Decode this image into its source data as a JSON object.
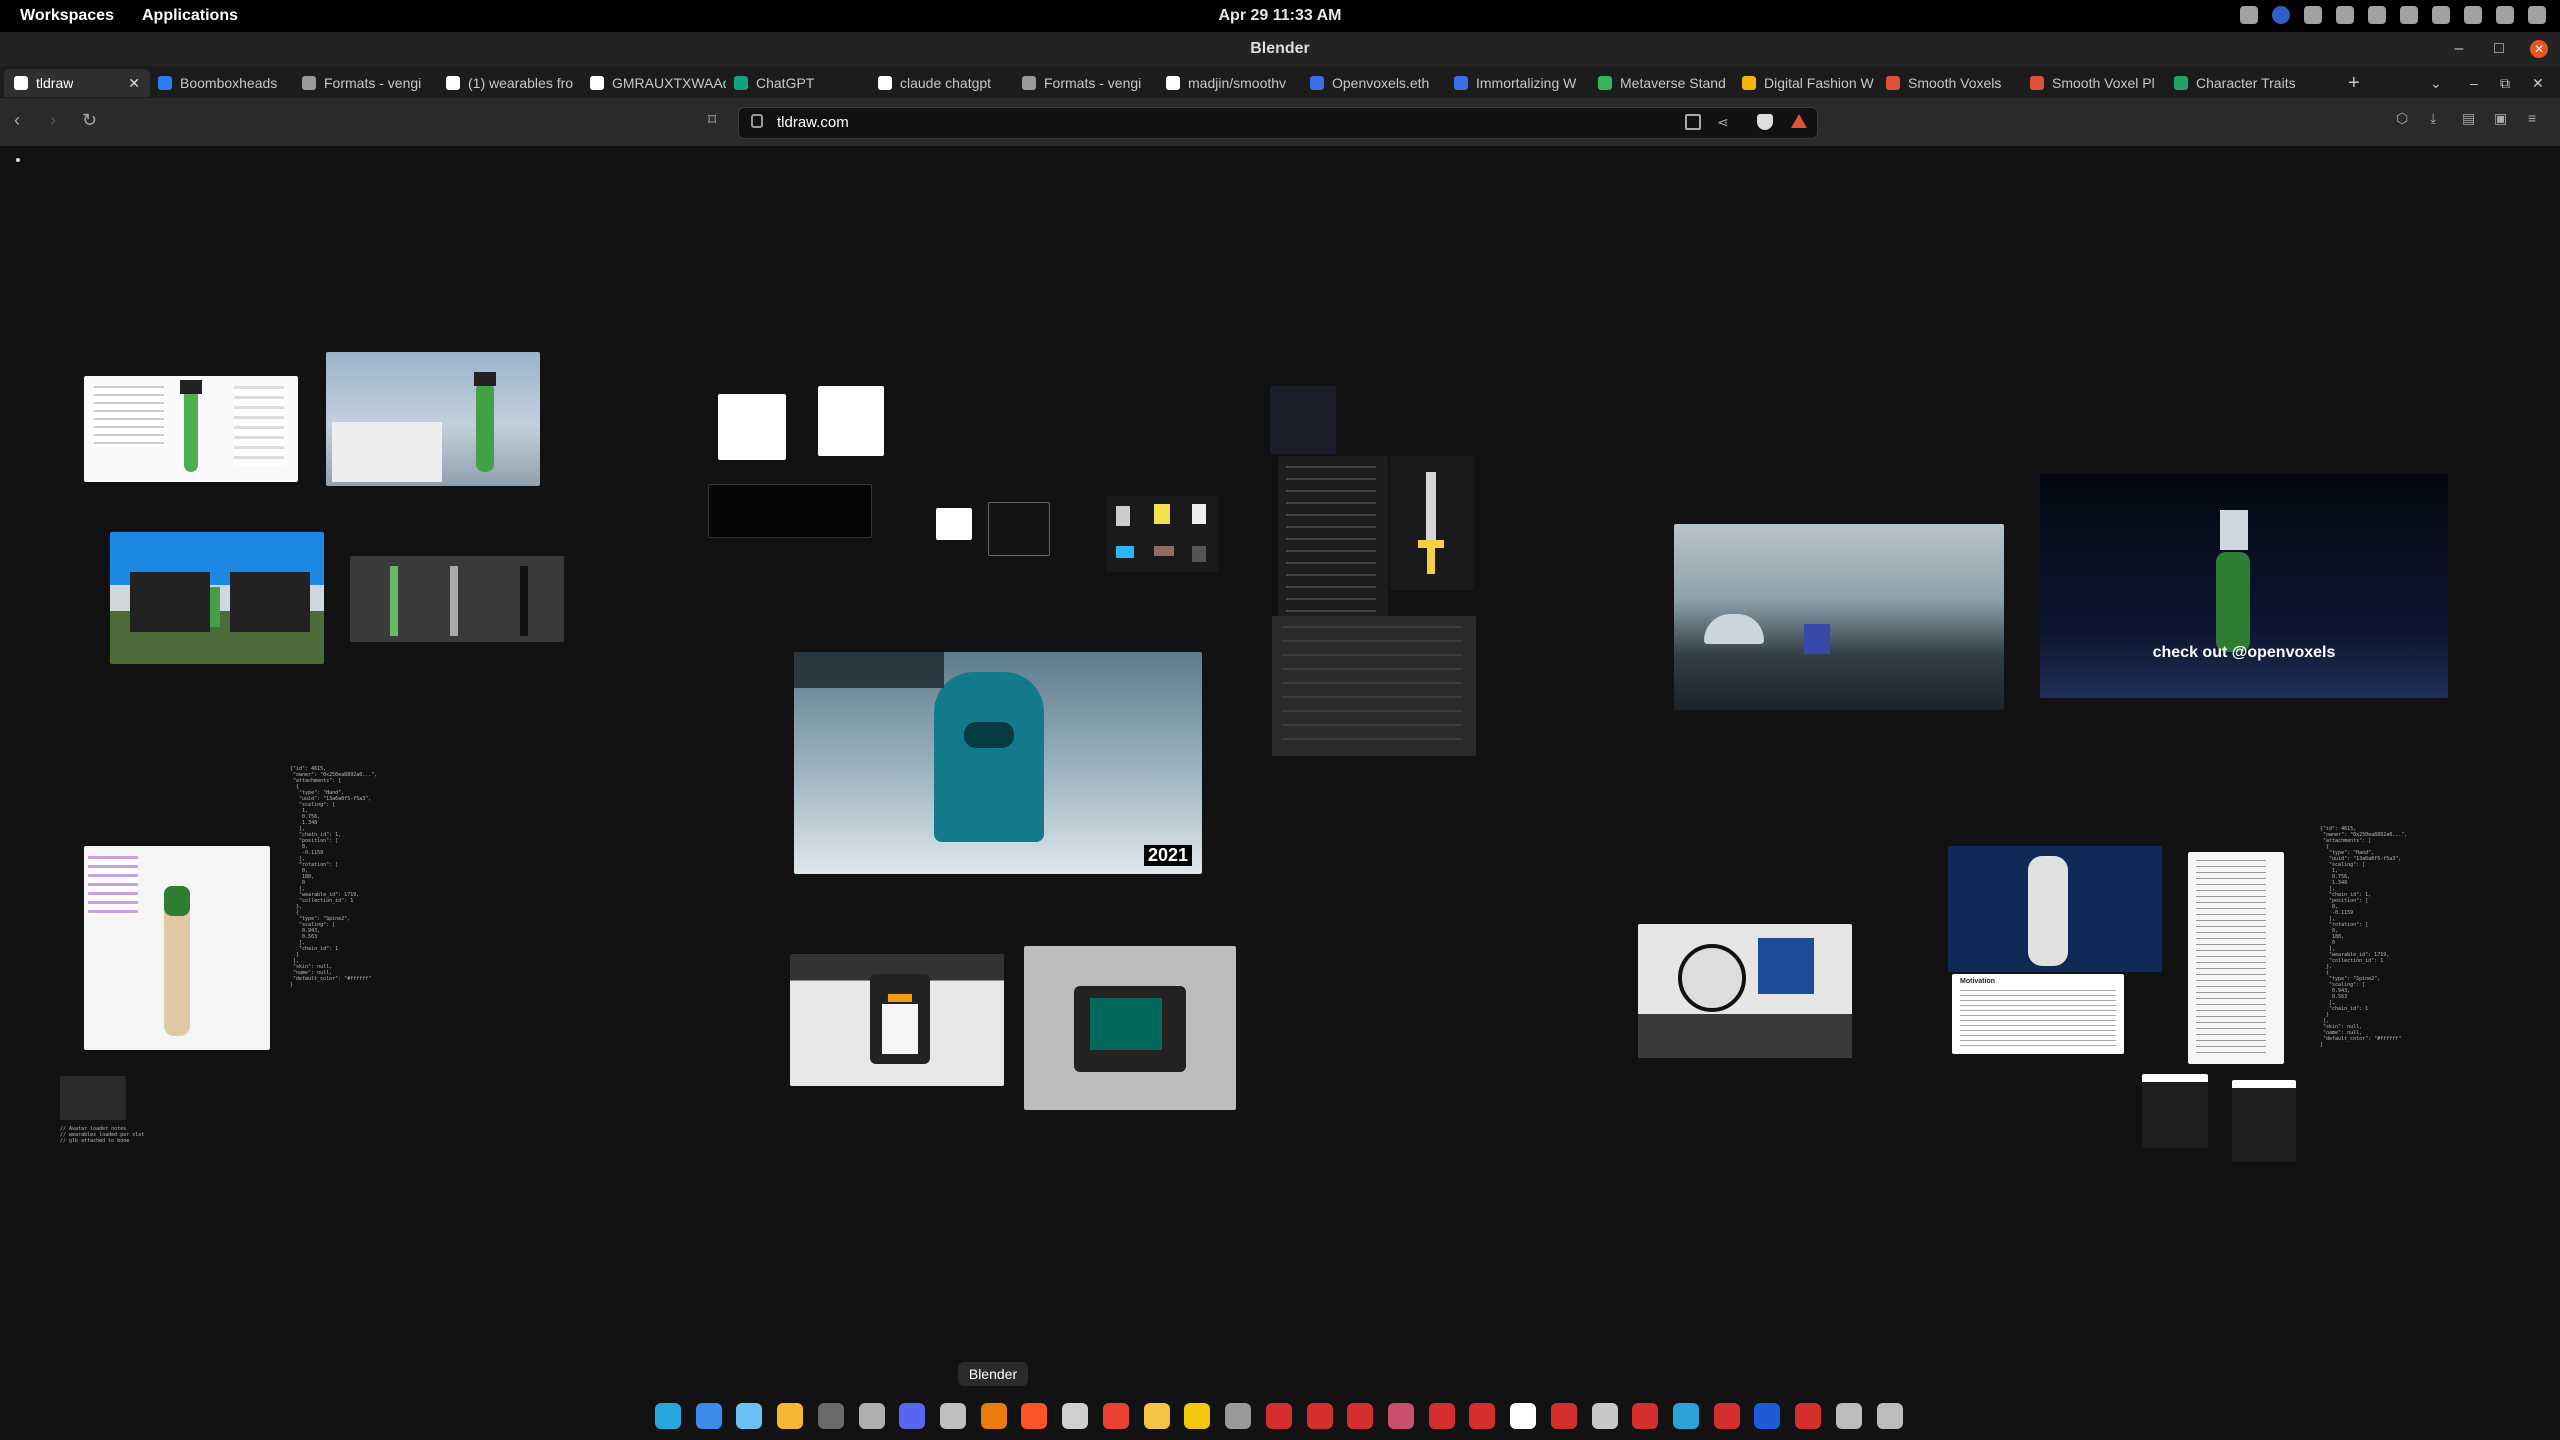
{
  "topbar": {
    "workspaces": "Workspaces",
    "applications": "Applications",
    "clock": "Apr 29  11:33 AM"
  },
  "window": {
    "title": "Blender"
  },
  "tabs": [
    {
      "label": "tldraw",
      "color": "#ffffff",
      "icon": "tldraw-icon"
    },
    {
      "label": "Boomboxheads",
      "color": "#2d7cf6",
      "icon": "boomboxheads-icon"
    },
    {
      "label": "Formats - vengi",
      "color": "#9a9a9a",
      "icon": "vengi-icon"
    },
    {
      "label": "(1) wearables fro",
      "color": "#ffffff",
      "icon": "x-icon"
    },
    {
      "label": "GMRAUXTXWAAdi",
      "color": "#ffffff",
      "icon": "x-icon"
    },
    {
      "label": "ChatGPT",
      "color": "#10a37f",
      "icon": "chatgpt-icon"
    },
    {
      "label": "claude chatgpt",
      "color": "#ffffff",
      "icon": "google-icon"
    },
    {
      "label": "Formats - vengi",
      "color": "#9a9a9a",
      "icon": "vengi-icon"
    },
    {
      "label": "madjin/smoothv",
      "color": "#ffffff",
      "icon": "github-icon"
    },
    {
      "label": "Openvoxels.eth",
      "color": "#3a6ee8",
      "icon": "openvoxels-icon"
    },
    {
      "label": "Immortalizing W",
      "color": "#3a6ee8",
      "icon": "immortalizing-icon"
    },
    {
      "label": "Metaverse Stand",
      "color": "#2fb55a",
      "icon": "metaverse-icon"
    },
    {
      "label": "Digital Fashion W",
      "color": "#f4b400",
      "icon": "drive-icon"
    },
    {
      "label": "Smooth Voxels",
      "color": "#e0533b",
      "icon": "smoothvoxels-icon"
    },
    {
      "label": "Smooth Voxel Pl",
      "color": "#e0533b",
      "icon": "smoothvoxels-icon"
    },
    {
      "label": "Character Traits",
      "color": "#1fa463",
      "icon": "sheets-icon"
    }
  ],
  "address": {
    "url": "tldraw.com"
  },
  "canvas": {
    "caption": "check out @openvoxels",
    "year": "2021",
    "motivation_heading": "Motivation"
  },
  "dock": {
    "tooltip": "Blender",
    "icons": [
      "#29a8e0",
      "#3d8be8",
      "#6ec1f5",
      "#f7b733",
      "#6a6a6a",
      "#b0b0b0",
      "#5865f2",
      "#c0c0c0",
      "#e87d0d",
      "#fb542b",
      "#cfcfcf",
      "#ea4335",
      "#f6c445",
      "#f2c811",
      "#9a9a9a",
      "#d32f2f",
      "#d32f2f",
      "#d32f2f",
      "#c94f6d",
      "#d32f2f",
      "#d32f2f",
      "#ffffff",
      "#d32f2f",
      "#c8c8c8",
      "#d32f2f",
      "#2aa2d8",
      "#d32f2f",
      "#1e5bd8",
      "#d32f2f",
      "#bdbdbd",
      "#bdbdbd"
    ]
  }
}
